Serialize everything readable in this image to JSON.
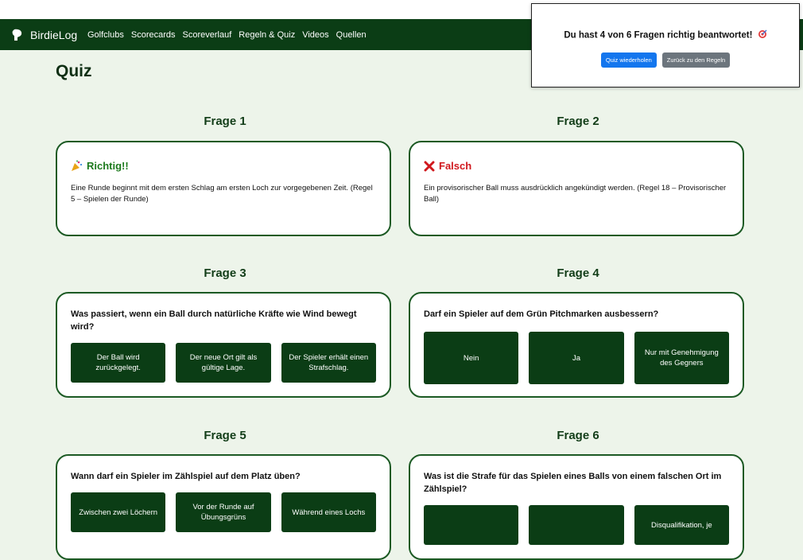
{
  "navbar": {
    "brand": "BirdieLog",
    "links": [
      "Golfclubs",
      "Scorecards",
      "Scoreverlauf",
      "Regeln & Quiz",
      "Videos",
      "Quellen"
    ]
  },
  "page": {
    "title": "Quiz"
  },
  "questions": [
    {
      "heading": "Frage 1",
      "state": "answered",
      "result": "Richtig!!",
      "explanation": "Eine Runde beginnt mit dem ersten Schlag am ersten Loch zur vorgegebenen Zeit. (Regel 5 – Spielen der Runde)"
    },
    {
      "heading": "Frage 2",
      "state": "answered",
      "result": "Falsch",
      "explanation": "Ein provisorischer Ball muss ausdrücklich angekündigt werden. (Regel 18 – Provisorischer Ball)"
    },
    {
      "heading": "Frage 3",
      "state": "open",
      "question": "Was passiert, wenn ein Ball durch natürliche Kräfte wie Wind bewegt wird?",
      "answers": [
        "Der Ball wird zurückgelegt.",
        "Der neue Ort gilt als gültige Lage.",
        "Der Spieler erhält einen Strafschlag."
      ]
    },
    {
      "heading": "Frage 4",
      "state": "open",
      "question": "Darf ein Spieler auf dem Grün Pitchmarken ausbessern?",
      "answers": [
        "Nein",
        "Ja",
        "Nur mit Genehmigung des Gegners"
      ]
    },
    {
      "heading": "Frage 5",
      "state": "open",
      "question": "Wann darf ein Spieler im Zählspiel auf dem Platz üben?",
      "answers": [
        "Zwischen zwei Löchern",
        "Vor der Runde auf Übungsgrüns",
        "Während eines Lochs"
      ]
    },
    {
      "heading": "Frage 6",
      "state": "open",
      "question": "Was ist die Strafe für das Spielen eines Balls von einem falschen Ort im Zählspiel?",
      "answers": [
        "",
        "",
        "Disqualifikation, je"
      ]
    }
  ],
  "popup": {
    "message": "Du hast 4 von 6 Fragen richtig beantwortet!",
    "retry_label": "Quiz wiederholen",
    "back_label": "Zurück zu den Regeln"
  },
  "colors": {
    "navbar": "#0b3d15",
    "answer_button": "#0b3d15",
    "correct": "#1d7a1d",
    "wrong": "#d0181d",
    "page_bg": "#edf4ea",
    "primary_button": "#1376ee"
  },
  "icons": {
    "brand": "golfer-icon",
    "correct": "party-popper-icon",
    "wrong": "cross-mark-icon",
    "popup": "target-icon"
  }
}
